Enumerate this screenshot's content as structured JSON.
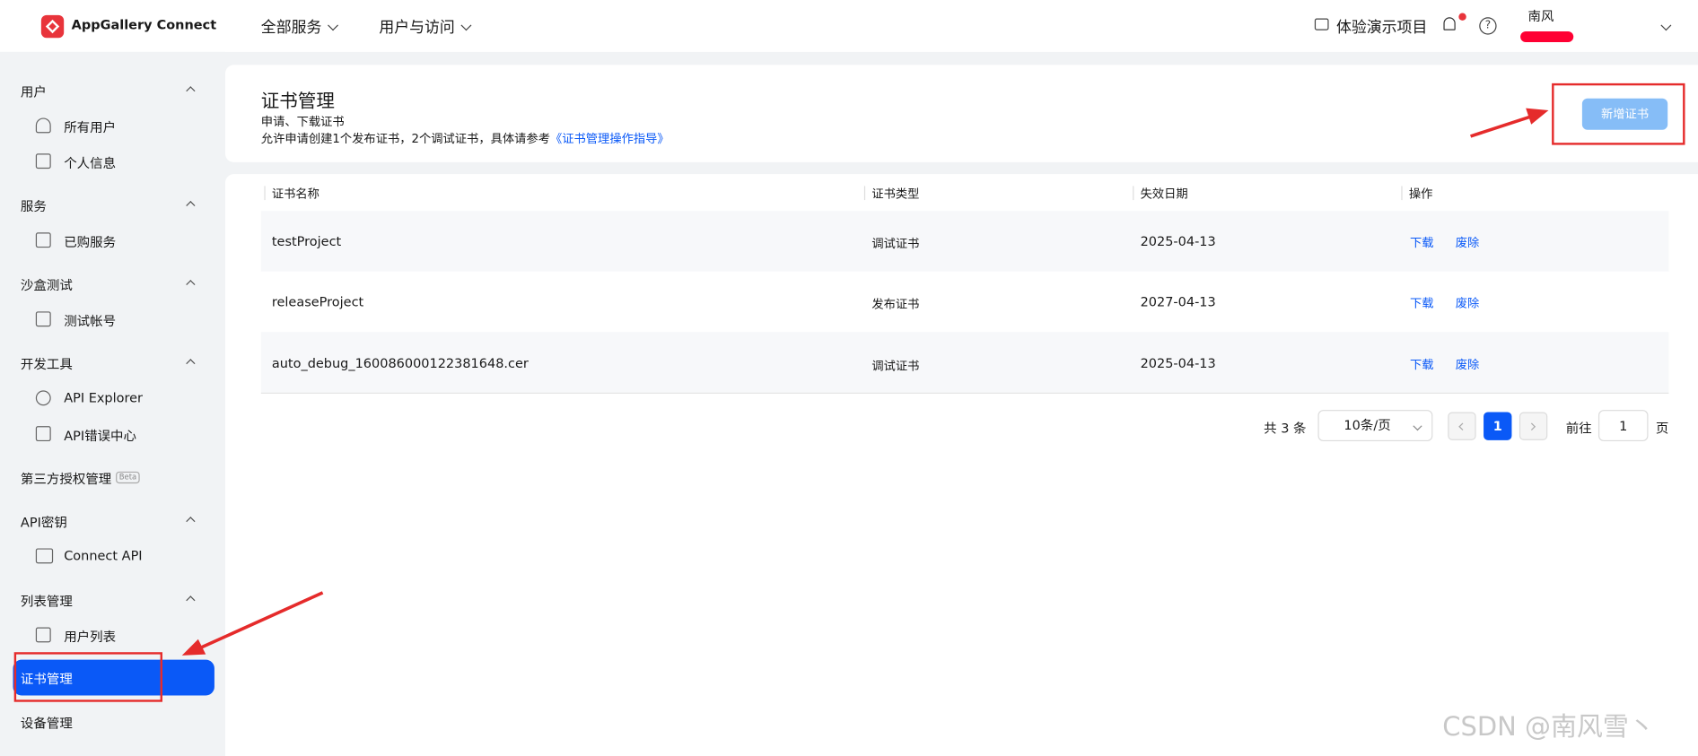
{
  "header": {
    "brand": "AppGallery Connect",
    "menus": [
      "全部服务",
      "用户与访问"
    ],
    "demo_label": "体验演示项目",
    "help_glyph": "?",
    "user_name": "南风"
  },
  "sidebar": {
    "sections": [
      {
        "label": "用户",
        "items": [
          "所有用户",
          "个人信息"
        ]
      },
      {
        "label": "服务",
        "items": [
          "已购服务"
        ]
      },
      {
        "label": "沙盒测试",
        "items": [
          "测试帐号"
        ]
      },
      {
        "label": "开发工具",
        "items": [
          "API Explorer",
          "API错误中心"
        ]
      },
      {
        "label": "第三方授权管理",
        "badge": "Beta"
      },
      {
        "label": "API密钥",
        "items": [
          "Connect API"
        ]
      },
      {
        "label": "列表管理",
        "items": [
          "用户列表"
        ]
      }
    ],
    "active": "证书管理",
    "last": "设备管理"
  },
  "page": {
    "title": "证书管理",
    "subtitle": "申请、下载证书",
    "note": "允许申请创建1个发布证书，2个调试证书，具体请参考",
    "note_link": "《证书管理操作指导》",
    "new_button": "新增证书"
  },
  "table": {
    "columns": [
      "证书名称",
      "证书类型",
      "失效日期",
      "操作"
    ],
    "rows": [
      {
        "name": "testProject",
        "type": "调试证书",
        "expiry": "2025-04-13",
        "actions": [
          "下载",
          "废除"
        ]
      },
      {
        "name": "releaseProject",
        "type": "发布证书",
        "expiry": "2027-04-13",
        "actions": [
          "下载",
          "废除"
        ]
      },
      {
        "name": "auto_debug_160086000122381648.cer",
        "type": "调试证书",
        "expiry": "2025-04-13",
        "actions": [
          "下载",
          "废除"
        ]
      }
    ]
  },
  "pagination": {
    "total": "共 3 条",
    "page_size": "10条/页",
    "current_page": "1",
    "goto_label": "前往",
    "goto_value": "1",
    "unit": "页"
  },
  "watermark": "CSDN @南风雪丶",
  "colors": {
    "accent": "#0a59f7",
    "brand_red": "#e8343b",
    "annotation": "#e52b2b"
  }
}
